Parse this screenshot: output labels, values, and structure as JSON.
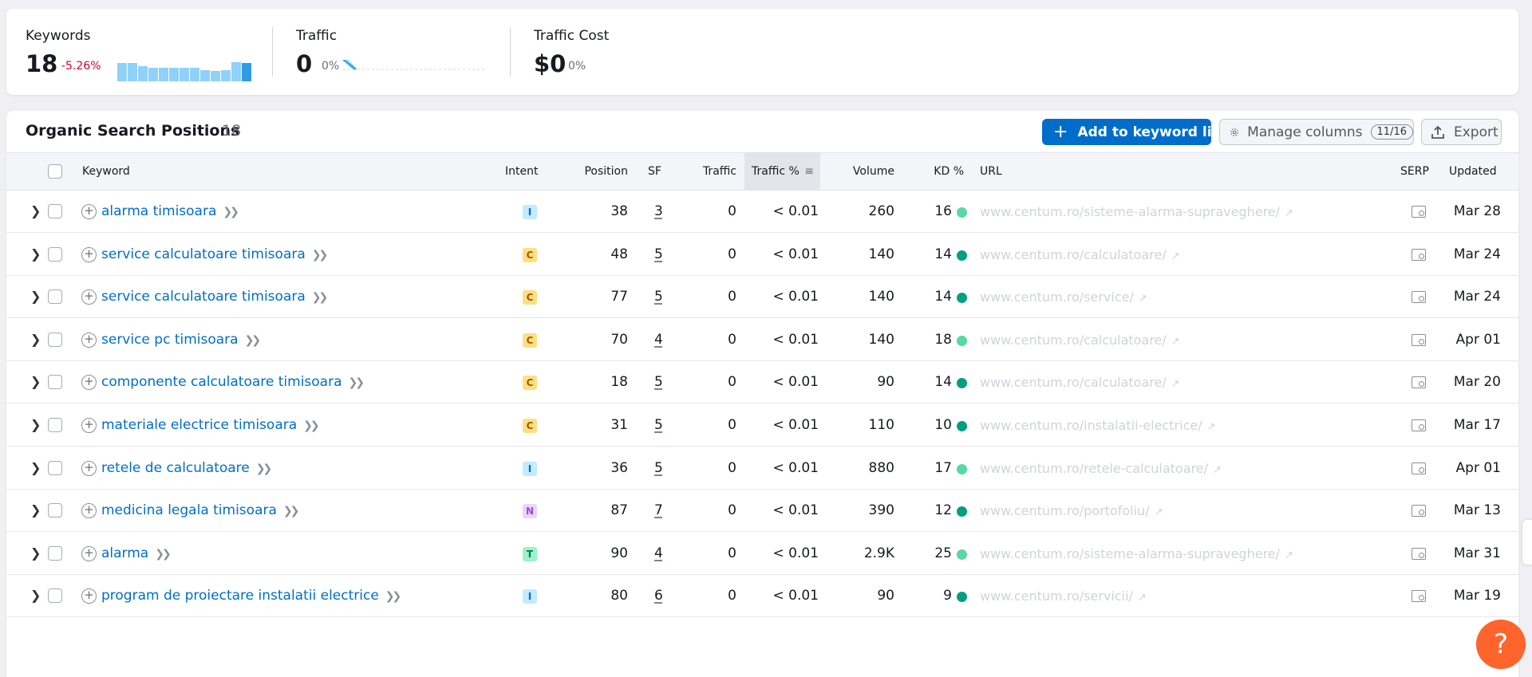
{
  "summary": {
    "keywords": {
      "label": "Keywords",
      "value": "18",
      "delta": "-5.26%",
      "bars": [
        0.95,
        0.95,
        0.8,
        0.7,
        0.7,
        0.7,
        0.7,
        0.7,
        0.6,
        0.55,
        0.6,
        1.0,
        0.95
      ]
    },
    "traffic": {
      "label": "Traffic",
      "value": "0",
      "delta": "0%"
    },
    "traffic_cost": {
      "label": "Traffic Cost",
      "value": "$0",
      "delta": "0%"
    }
  },
  "positions": {
    "title": "Organic Search Positions",
    "count": "18",
    "add_button": "Add to keyword list",
    "manage_button": "Manage columns",
    "manage_badge": "11/16",
    "export_button": "Export",
    "columns": {
      "keyword": "Keyword",
      "intent": "Intent",
      "position": "Position",
      "sf": "SF",
      "traffic": "Traffic",
      "traffic_pct": "Traffic %",
      "volume": "Volume",
      "kd": "KD %",
      "url": "URL",
      "serp": "SERP",
      "updated": "Updated"
    },
    "rows": [
      {
        "keyword": "alarma timisoara",
        "intent": "I",
        "position": "38",
        "sf": "3",
        "traffic": "0",
        "traffic_pct": "< 0.01",
        "volume": "260",
        "kd": "16",
        "kd_color": "#59d8a1",
        "url": "www.centum.ro/sisteme-alarma-supraveghere/",
        "updated": "Mar 28"
      },
      {
        "keyword": "service calculatoare timisoara",
        "intent": "C",
        "position": "48",
        "sf": "5",
        "traffic": "0",
        "traffic_pct": "< 0.01",
        "volume": "140",
        "kd": "14",
        "kd_color": "#009f81",
        "url": "www.centum.ro/calculatoare/",
        "updated": "Mar 24"
      },
      {
        "keyword": "service calculatoare timisoara",
        "intent": "C",
        "position": "77",
        "sf": "5",
        "traffic": "0",
        "traffic_pct": "< 0.01",
        "volume": "140",
        "kd": "14",
        "kd_color": "#009f81",
        "url": "www.centum.ro/service/",
        "updated": "Mar 24"
      },
      {
        "keyword": "service pc timisoara",
        "intent": "C",
        "position": "70",
        "sf": "4",
        "traffic": "0",
        "traffic_pct": "< 0.01",
        "volume": "140",
        "kd": "18",
        "kd_color": "#59d8a1",
        "url": "www.centum.ro/calculatoare/",
        "updated": "Apr 01"
      },
      {
        "keyword": "componente calculatoare timisoara",
        "intent": "C",
        "position": "18",
        "sf": "5",
        "traffic": "0",
        "traffic_pct": "< 0.01",
        "volume": "90",
        "kd": "14",
        "kd_color": "#009f81",
        "url": "www.centum.ro/calculatoare/",
        "updated": "Mar 20"
      },
      {
        "keyword": "materiale electrice timisoara",
        "intent": "C",
        "position": "31",
        "sf": "5",
        "traffic": "0",
        "traffic_pct": "< 0.01",
        "volume": "110",
        "kd": "10",
        "kd_color": "#009f81",
        "url": "www.centum.ro/instalatii-electrice/",
        "updated": "Mar 17"
      },
      {
        "keyword": "retele de calculatoare",
        "intent": "I",
        "position": "36",
        "sf": "5",
        "traffic": "0",
        "traffic_pct": "< 0.01",
        "volume": "880",
        "kd": "17",
        "kd_color": "#59d8a1",
        "url": "www.centum.ro/retele-calculatoare/",
        "updated": "Apr 01"
      },
      {
        "keyword": "medicina legala timisoara",
        "intent": "N",
        "position": "87",
        "sf": "7",
        "traffic": "0",
        "traffic_pct": "< 0.01",
        "volume": "390",
        "kd": "12",
        "kd_color": "#009f81",
        "url": "www.centum.ro/portofoliu/",
        "updated": "Mar 13"
      },
      {
        "keyword": "alarma",
        "intent": "T",
        "position": "90",
        "sf": "4",
        "traffic": "0",
        "traffic_pct": "< 0.01",
        "volume": "2.9K",
        "kd": "25",
        "kd_color": "#59d8a1",
        "url": "www.centum.ro/sisteme-alarma-supraveghere/",
        "updated": "Mar 31"
      },
      {
        "keyword": "program de proiectare instalatii electrice",
        "intent": "I",
        "position": "80",
        "sf": "6",
        "traffic": "0",
        "traffic_pct": "< 0.01",
        "volume": "90",
        "kd": "9",
        "kd_color": "#009f81",
        "url": "www.centum.ro/servicii/",
        "updated": "Mar 19"
      }
    ]
  },
  "intent_colors": {
    "I": {
      "bg": "#c2ebff",
      "fg": "#006dca"
    },
    "C": {
      "bg": "#fce081",
      "fg": "#a75800"
    },
    "N": {
      "bg": "#e9d5ff",
      "fg": "#9d4ad9"
    },
    "T": {
      "bg": "#9ef2c9",
      "fg": "#007c65"
    }
  },
  "help_label": "?"
}
